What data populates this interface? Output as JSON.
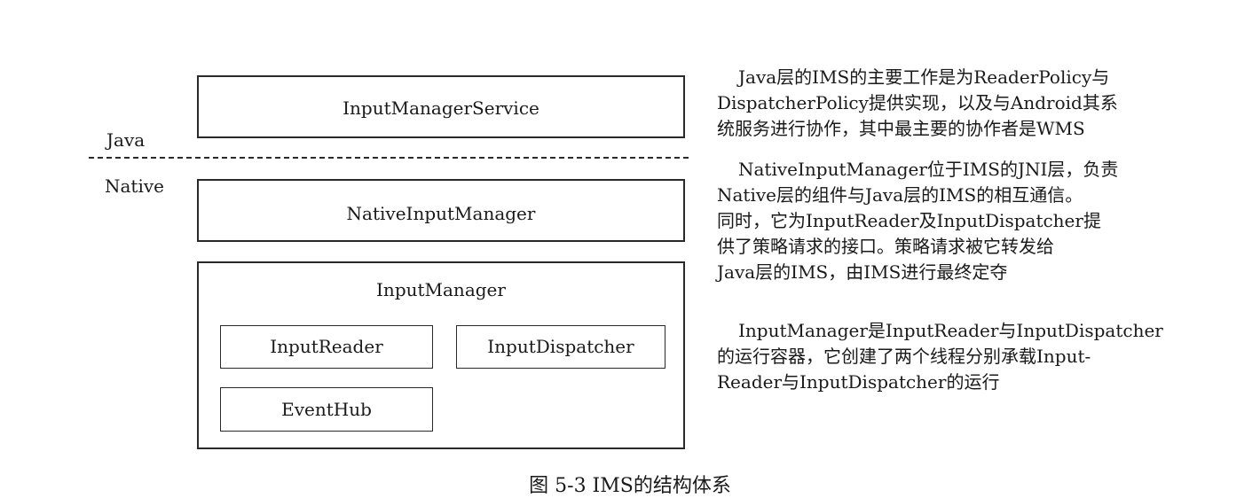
{
  "layers": {
    "java": "Java",
    "native": "Native"
  },
  "boxes": {
    "ims": "InputManagerService",
    "native_input_manager": "NativeInputManager",
    "input_manager": "InputManager",
    "input_reader": "InputReader",
    "input_dispatcher": "InputDispatcher",
    "event_hub": "EventHub"
  },
  "descriptions": {
    "ims": [
      "Java层的IMS的主要工作是为ReaderPolicy与",
      "DispatcherPolicy提供实现，以及与Android其系",
      "统服务进行协作，其中最主要的协作者是WMS"
    ],
    "native_input_manager": [
      "NativeInputManager位于IMS的JNI层，负责",
      "Native层的组件与Java层的IMS的相互通信。",
      "同时，它为InputReader及InputDispatcher提",
      "供了策略请求的接口。策略请求被它转发给",
      "Java层的IMS，由IMS进行最终定夺"
    ],
    "input_manager": [
      "InputManager是InputReader与InputDispatcher",
      "的运行容器，它创建了两个线程分别承载Input-",
      "Reader与InputDispatcher的运行"
    ]
  },
  "caption": "图 5-3  IMS的结构体系"
}
